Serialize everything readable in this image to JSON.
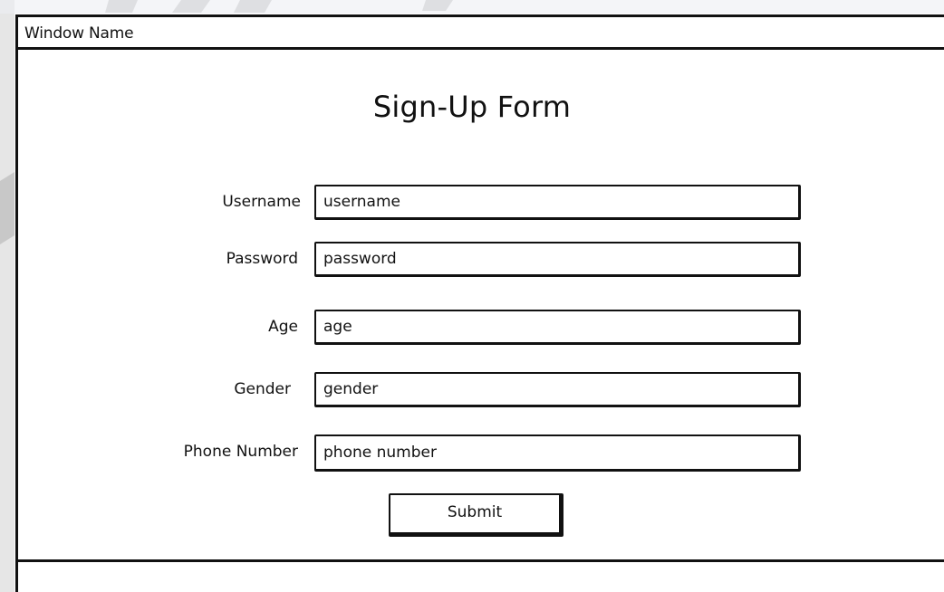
{
  "window": {
    "title": "Window Name"
  },
  "form": {
    "title": "Sign-Up Form",
    "fields": [
      {
        "label": "Username",
        "value": "username"
      },
      {
        "label": "Password",
        "value": "password"
      },
      {
        "label": "Age",
        "value": "age"
      },
      {
        "label": "Gender",
        "value": "gender"
      },
      {
        "label": "Phone Number",
        "value": "phone number"
      }
    ],
    "submit_label": "Submit"
  }
}
